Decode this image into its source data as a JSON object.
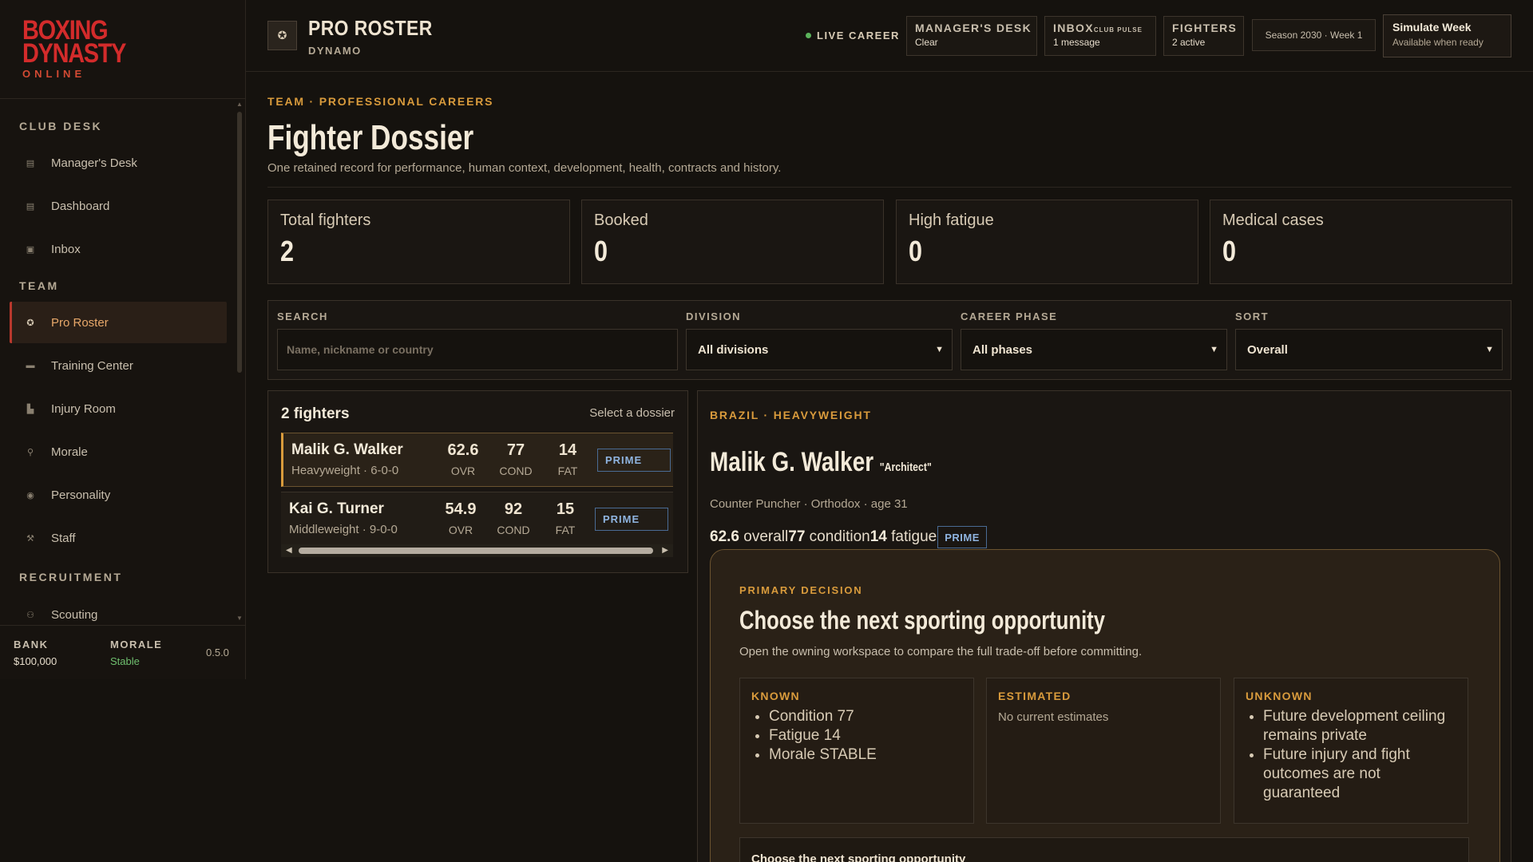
{
  "sidebar": {
    "logo": {
      "line1": "Boxing",
      "line2": "Dynasty",
      "line3": "ONLINE"
    },
    "sections": {
      "club_desk": "CLUB DESK",
      "team": "TEAM",
      "recruitment": "RECRUITMENT"
    },
    "items": [
      {
        "label": "Manager's Desk",
        "icon": "desk-icon"
      },
      {
        "label": "Dashboard",
        "icon": "dashboard-icon"
      },
      {
        "label": "Inbox",
        "icon": "inbox-icon"
      },
      {
        "label": "Pro Roster",
        "icon": "roster-icon",
        "active": true
      },
      {
        "label": "Training Center",
        "icon": "training-icon"
      },
      {
        "label": "Injury Room",
        "icon": "injury-icon"
      },
      {
        "label": "Morale",
        "icon": "morale-icon"
      },
      {
        "label": "Personality",
        "icon": "personality-icon"
      },
      {
        "label": "Staff",
        "icon": "staff-icon"
      },
      {
        "label": "Scouting",
        "icon": "scouting-icon"
      }
    ],
    "footer": {
      "bank_label": "BANK",
      "bank_value": "$100,000",
      "morale_label": "MORALE",
      "morale_value": "Stable",
      "version": "0.5.0"
    }
  },
  "header": {
    "title": "PRO ROSTER",
    "subtitle": "DYNAMO",
    "live": "LIVE CAREER",
    "managers_desk": {
      "title": "MANAGER'S DESK",
      "status": "Clear"
    },
    "inbox": {
      "title": "INBOX",
      "tag": "CLUB PULSE",
      "status": "1 message"
    },
    "fighters": {
      "title": "FIGHTERS",
      "status": "2 active"
    },
    "season": "Season 2030 · Week 1",
    "simulate": {
      "title": "Simulate Week",
      "status": "Available when ready"
    }
  },
  "page": {
    "eyebrow": "TEAM · PROFESSIONAL CAREERS",
    "title": "Fighter Dossier",
    "description": "One retained record for performance, human context, development, health, contracts and history."
  },
  "stats": [
    {
      "label": "Total fighters",
      "value": "2"
    },
    {
      "label": "Booked",
      "value": "0"
    },
    {
      "label": "High fatigue",
      "value": "0"
    },
    {
      "label": "Medical cases",
      "value": "0"
    }
  ],
  "filters": {
    "search_label": "SEARCH",
    "search_placeholder": "Name, nickname or country",
    "division_label": "DIVISION",
    "division_value": "All divisions",
    "phase_label": "CAREER PHASE",
    "phase_value": "All phases",
    "sort_label": "SORT",
    "sort_value": "Overall"
  },
  "roster": {
    "count": "2 fighters",
    "hint": "Select a dossier",
    "columns": {
      "ovr": "OVR",
      "cond": "COND",
      "fat": "FAT"
    },
    "fighters": [
      {
        "name": "Malik G. Walker",
        "meta": "Heavyweight · 6-0-0",
        "ovr": "62.6",
        "cond": "77",
        "fat": "14",
        "phase": "PRIME",
        "selected": true
      },
      {
        "name": "Kai G. Turner",
        "meta": "Middleweight · 9-0-0",
        "ovr": "54.9",
        "cond": "92",
        "fat": "15",
        "phase": "PRIME",
        "selected": false
      }
    ]
  },
  "detail": {
    "eyebrow": "BRAZIL · HEAVYWEIGHT",
    "name": "Malik G. Walker",
    "nickname": "\"Architect\"",
    "meta": "Counter Puncher · Orthodox · age 31",
    "overall": "62.6",
    "overall_label": "overall",
    "condition": "77",
    "condition_label": "condition",
    "fatigue": "14",
    "fatigue_label": "fatigue",
    "phase": "PRIME",
    "decision": {
      "eyebrow": "PRIMARY DECISION",
      "title": "Choose the next sporting opportunity",
      "description": "Open the owning workspace to compare the full trade-off before committing.",
      "known": {
        "title": "KNOWN",
        "items": [
          "Condition 77",
          "Fatigue 14",
          "Morale STABLE"
        ]
      },
      "estimated": {
        "title": "ESTIMATED",
        "text": "No current estimates"
      },
      "unknown": {
        "title": "UNKNOWN",
        "items": [
          "Future development ceiling remains private",
          "Future injury and fight outcomes are not guaranteed"
        ]
      },
      "action": "Choose the next sporting opportunity"
    }
  },
  "colors": {
    "accent": "#d99b3c",
    "brand_red": "#d32b2b",
    "active_nav": "#e8a86a",
    "badge_blue": "#8fb4e0",
    "live_green": "#5bb35b"
  }
}
